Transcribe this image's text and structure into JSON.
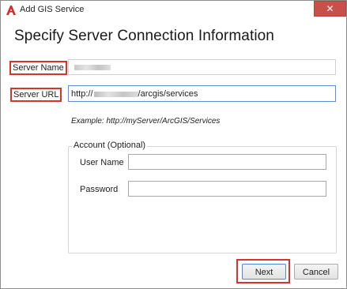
{
  "window": {
    "title": "Add GIS Service",
    "close_label": "✕"
  },
  "heading": "Specify Server Connection Information",
  "fields": {
    "server_name_label": "Server Name",
    "server_name_value": "",
    "server_url_label": "Server URL",
    "server_url_prefix": "http://",
    "server_url_suffix": "/arcgis/services",
    "example": "Example: http://myServer/ArcGIS/Services"
  },
  "account": {
    "group_title": "Account (Optional)",
    "user_name_label": "User Name",
    "user_name_value": "",
    "password_label": "Password",
    "password_value": ""
  },
  "buttons": {
    "next": "Next",
    "cancel": "Cancel"
  },
  "colors": {
    "highlight": "#d9342b",
    "close_button": "#c7504a",
    "focus_border": "#5b8fd6"
  },
  "icons": {
    "app": "autocad-a-icon",
    "close": "close-icon"
  }
}
